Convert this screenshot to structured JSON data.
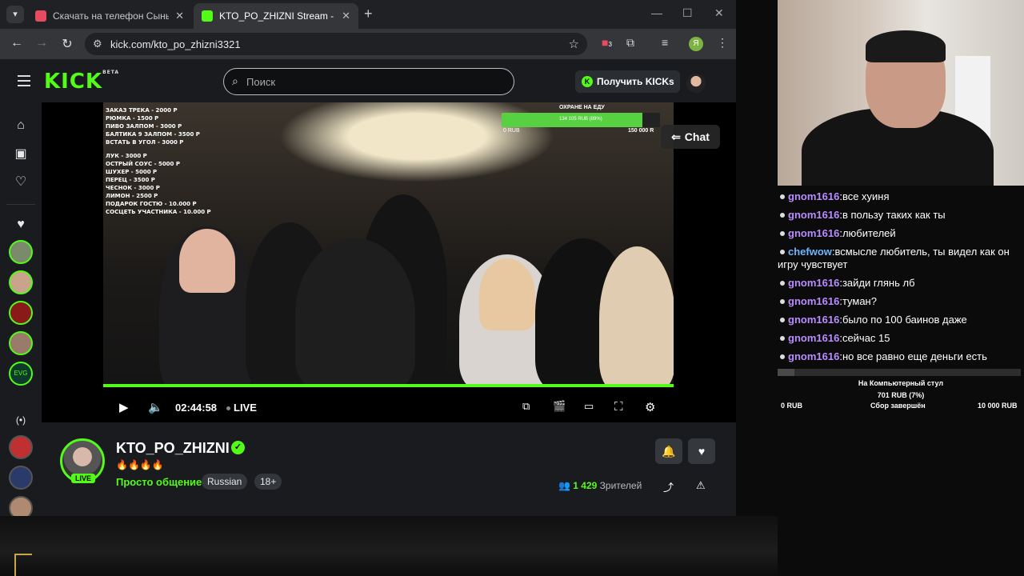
{
  "browser": {
    "tabs": [
      {
        "title": "Скачать на телефон Сыны ане",
        "favicon_color": "#e84a5f"
      },
      {
        "title": "KTO_PO_ZHIZNI Stream - Watc",
        "favicon_color": "#53fc18"
      }
    ],
    "url": "kick.com/kto_po_zhizni3321",
    "extension_badge": "3",
    "profile_letter": "Я"
  },
  "kick": {
    "logo": "KICK",
    "logo_badge": "BETA",
    "search_placeholder": "Поиск",
    "get_kicks_label": "Получить KICKs",
    "chat_button": "Chat",
    "player": {
      "time": "02:44:58",
      "live_label": "LIVE",
      "progress": 1.0
    },
    "stream_overlay": {
      "price_list": [
        "ЗАКАЗ ТРЕКА - 2000 Р",
        "РЮМКА - 1500 Р",
        "ПИВО ЗАЛПОМ - 3000 Р",
        "БАЛТИКА 9 ЗАЛПОМ - 3500 Р",
        "ВСТАТЬ В УГОЛ - 3000 Р",
        "",
        "ЛУК - 3000 Р",
        "ОСТРЫЙ СОУС - 5000 Р",
        "ШУХЕР - 5000 Р",
        "ПЕРЕЦ - 3500 Р",
        "ЧЕСНОК - 3000 Р",
        "ЛИМОН - 2500 Р",
        "ПОДАРОК ГОСТЮ - 10.000 Р",
        "СОСЦЕТЬ УЧАСТНИКА - 10.000 Р"
      ],
      "goal_title": "ОХРАНЕ НА ЕДУ",
      "goal_label": "134 105 RUB (89%)",
      "goal_fraction": 0.89,
      "goal_min": "0 RUB",
      "goal_max": "150 000 R"
    },
    "channel": {
      "name": "KTO_PO_ZHIZNI",
      "live_badge": "LIVE",
      "emoji_line": "🔥🔥🔥🔥",
      "category": "Просто общение",
      "tags": [
        "Russian",
        "18+"
      ],
      "viewer_count": "1 429",
      "viewer_label": "Зрителей"
    }
  },
  "chat": {
    "messages": [
      {
        "user": "gnom1616",
        "text": "все хуиня",
        "color": "purple"
      },
      {
        "user": "gnom1616",
        "text": "в пользу таких как ты",
        "color": "purple"
      },
      {
        "user": "gnom1616",
        "text": "любителей",
        "color": "purple"
      },
      {
        "user": "chefwow",
        "text": "всмысле любитель, ты видел как он игру чувствует",
        "color": "blue"
      },
      {
        "user": "gnom1616",
        "text": "зайди глянь лб",
        "color": "purple"
      },
      {
        "user": "gnom1616",
        "text": "туман?",
        "color": "purple"
      },
      {
        "user": "gnom1616",
        "text": "было по 100 баинов даже",
        "color": "purple"
      },
      {
        "user": "gnom1616",
        "text": "сейчас 15",
        "color": "purple"
      },
      {
        "user": "gnom1616",
        "text": "но все равно еще деньги есть",
        "color": "purple"
      }
    ]
  },
  "donation_goal": {
    "title": "На Компьютерный стул",
    "value": "701 RUB (7%)",
    "fraction": 0.07,
    "min": "0 RUB",
    "status": "Сбор завершён",
    "max": "10 000 RUB"
  },
  "colors": {
    "kick_green": "#53fc18",
    "chat_user_purple": "#b98cff",
    "chat_user_blue": "#6fb6ff",
    "page_bg": "#191b1f"
  }
}
